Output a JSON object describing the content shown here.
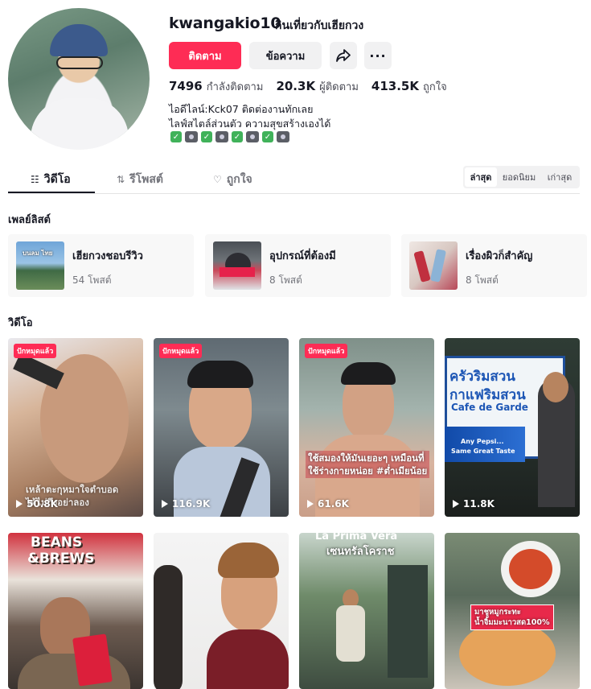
{
  "profile": {
    "username": "kwangakio10",
    "nickname": "กินเที่ยวกับเฮียกวง",
    "follow_label": "ติดตาม",
    "message_label": "ข้อความ",
    "more_label": "···",
    "stats": [
      {
        "value": "7496",
        "label": "กำลังติดตาม"
      },
      {
        "value": "20.3K",
        "label": "ผู้ติดตาม"
      },
      {
        "value": "413.5K",
        "label": "ถูกใจ"
      }
    ],
    "bio_line1": "ไอดีไลน์:Kck07 ติดต่องานทักเลย",
    "bio_line2": "ไลฟ์สไตล์ส่วนตัว ความสุขสร้างเองได้"
  },
  "tabs": [
    {
      "label": "วิดีโอ",
      "icon": "grid-icon"
    },
    {
      "label": "รีโพสต์",
      "icon": "repost-icon"
    },
    {
      "label": "ถูกใจ",
      "icon": "heart-icon"
    }
  ],
  "sort": {
    "latest": "ล่าสุด",
    "popular": "ยอดนิยม",
    "oldest": "เก่าสุด"
  },
  "playlists_title": "เพลย์ลิสต์",
  "playlists": [
    {
      "name": "เฮียกวงชอบรีวิว",
      "count": "54 โพสต์",
      "thumb_text": "บนลม ไทย"
    },
    {
      "name": "อุปกรณ์ที่ต้องมี",
      "count": "8 โพสต์"
    },
    {
      "name": "เรื่องผิวก็สำคัญ",
      "count": "8 โพสต์"
    }
  ],
  "videos_title": "วิดีโอ",
  "pinned_label": "ปักหมุดแล้ว",
  "videos": [
    {
      "views": "50.8K",
      "pinned": true,
      "overlay": "เหล้าตะกุหมาใจตำบอด\nได้ไม่ถึงอย่าลอง"
    },
    {
      "views": "116.9K",
      "pinned": true
    },
    {
      "views": "61.6K",
      "pinned": true,
      "overlay": "ใช้สมองให้มันเยอะๆ เหมือนที่\nใช้ร่างกายหน่อย #ต่ำเมียน้อย"
    },
    {
      "views": "11.8K",
      "pinned": false,
      "sign1": "ครัวริมสวน",
      "sign2": "กาแฟริมสวน",
      "sign3": "Cafe de Garde",
      "ad1": "Any Pepsi...",
      "ad2": "Same Great Taste"
    },
    {
      "views": "",
      "pinned": false,
      "sign1": "BEANS",
      "sign2": "&BREWS"
    },
    {
      "views": "",
      "pinned": false
    },
    {
      "views": "",
      "pinned": false,
      "sign1": "La Prima Vera",
      "sign2": "เซนทรัลโคราช"
    },
    {
      "views": "",
      "pinned": false,
      "overlay": "มาชูหมูกระทะ\nน้ำจิ้มมะนาวสด100%"
    }
  ],
  "colors": {
    "accent": "#fe2c55",
    "text": "#161823",
    "muted": "#73747b"
  }
}
